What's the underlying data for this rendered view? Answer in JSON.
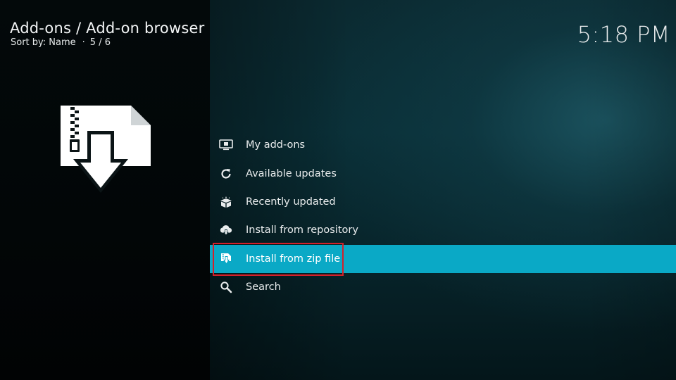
{
  "header": {
    "title": "Add-ons / Add-on browser",
    "sort_label": "Sort by: Name",
    "separator": "·",
    "position": "5 / 6"
  },
  "clock": {
    "time": "5:18 PM"
  },
  "preview_icon": {
    "name": "zip-file-install-icon"
  },
  "menu": {
    "items": [
      {
        "label": "My add-ons",
        "icon": "monitor-icon"
      },
      {
        "label": "Available updates",
        "icon": "refresh-icon"
      },
      {
        "label": "Recently updated",
        "icon": "open-box-icon"
      },
      {
        "label": "Install from repository",
        "icon": "cloud-download-icon"
      },
      {
        "label": "Install from zip file",
        "icon": "zip-install-icon",
        "focused": true
      },
      {
        "label": "Search",
        "icon": "search-icon"
      }
    ]
  },
  "colors": {
    "focus_bar": "#0aa9c6",
    "annotation_box": "#d4202a",
    "text": "#e9eced"
  }
}
